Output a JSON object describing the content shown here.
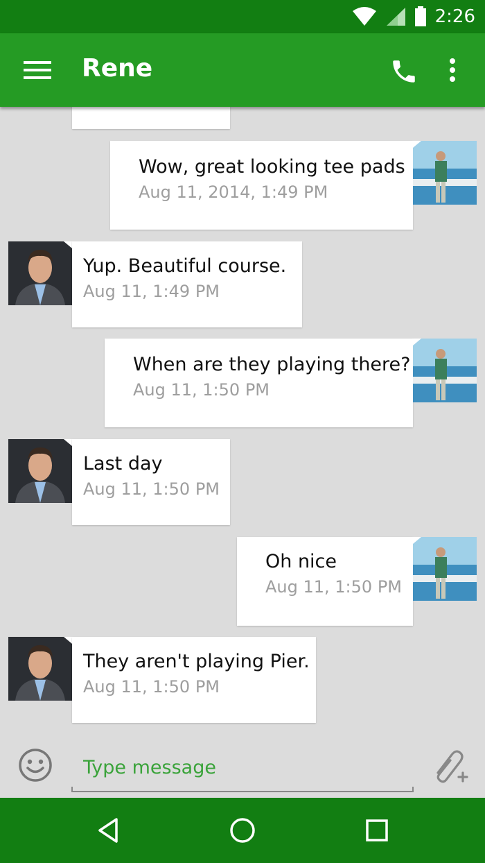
{
  "status_bar": {
    "time": "2:26",
    "icons": [
      "wifi-icon",
      "cell-signal-icon",
      "battery-icon"
    ]
  },
  "app_bar": {
    "title": "Rene",
    "icons": [
      "menu-icon",
      "phone-icon",
      "more-vert-icon"
    ]
  },
  "messages": [
    {
      "direction": "outgoing",
      "text": "",
      "time": ""
    },
    {
      "direction": "outgoing",
      "text": "Wow, great looking tee pads",
      "time": "Aug 11, 2014, 1:49 PM"
    },
    {
      "direction": "incoming",
      "text": "Yup. Beautiful course.",
      "time": "Aug 11, 1:49 PM"
    },
    {
      "direction": "outgoing",
      "text": "When are they playing there?",
      "time": "Aug 11, 1:50 PM"
    },
    {
      "direction": "incoming",
      "text": "Last day",
      "time": "Aug 11, 1:50 PM"
    },
    {
      "direction": "outgoing",
      "text": "Oh nice",
      "time": "Aug 11, 1:50 PM"
    },
    {
      "direction": "incoming",
      "text": "They aren't playing Pier.",
      "time": "Aug 11, 1:50 PM"
    }
  ],
  "composer": {
    "placeholder": "Type message",
    "icons": [
      "emoji-icon",
      "attach-icon"
    ]
  },
  "nav_bar": {
    "icons": [
      "back-icon",
      "home-icon",
      "recents-icon"
    ]
  },
  "colors": {
    "status_bar": "#127e12",
    "app_bar": "#259b24",
    "background": "#dcdcdc",
    "accent_text": "#3aa33a"
  }
}
